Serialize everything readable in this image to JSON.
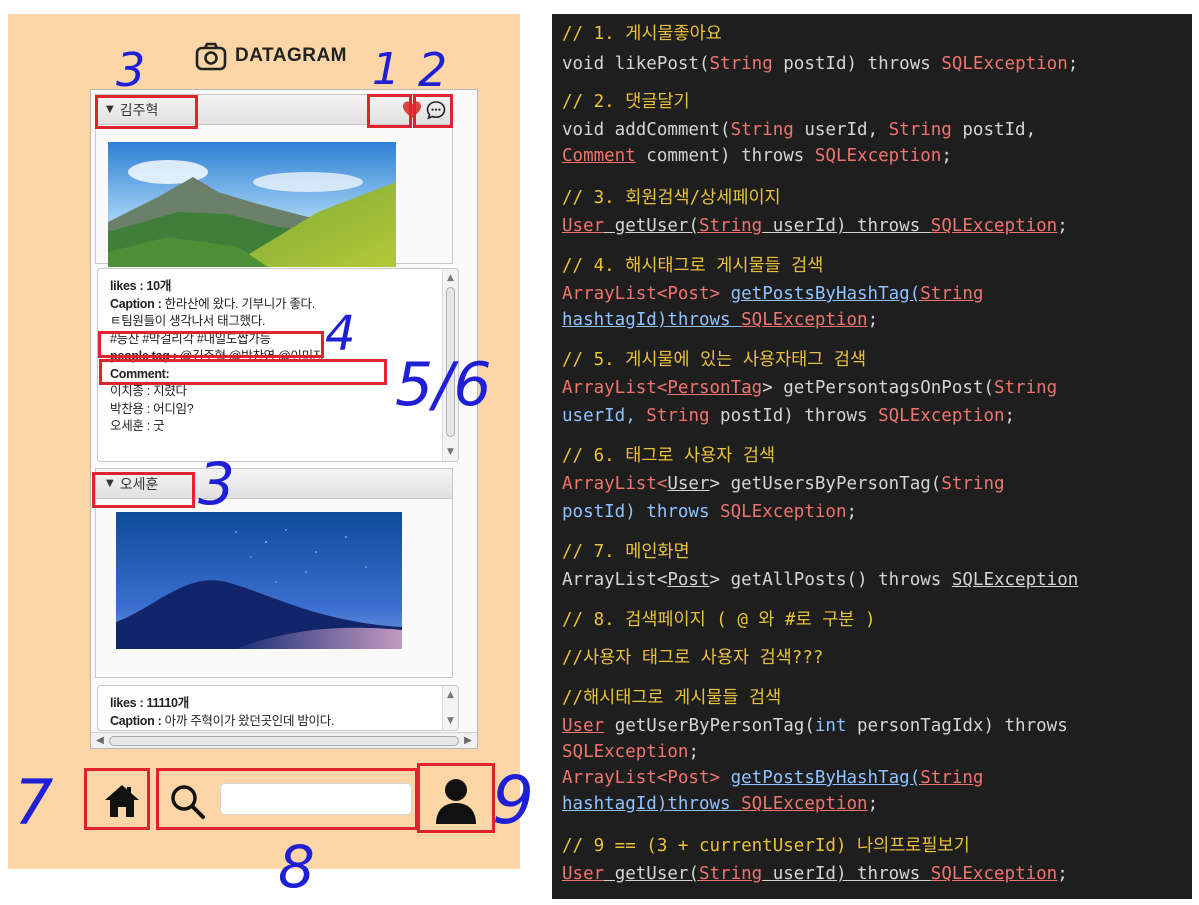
{
  "app": {
    "title": "DATAGRAM",
    "bg_color": "#fcd6a6",
    "icons": {
      "title": "camera-icon",
      "like": "heart-icon",
      "comment": "comment-icon",
      "home": "home-icon",
      "search": "search-icon",
      "profile": "user-icon"
    },
    "posts": [
      {
        "username": "김주혁",
        "likes_label": "likes : ",
        "likes_value": "10개",
        "caption_label": "Caption : ",
        "caption_text": "한라산에 왔다. 기부니가 좋다.",
        "caption_line2": "ㅌ팀원들이 생각나서 태그했다.",
        "hashtags": "#등산 #막걸리각 #내일도쌉가능",
        "people_tag_label": "people tag : ",
        "people_tags": "@김주혁 @박찬영 @이미자",
        "comment_label": "Comment:",
        "comments": [
          {
            "user": "이치종",
            "text": " : 지렸다"
          },
          {
            "user": "박찬용",
            "text": " : 어디임?"
          },
          {
            "user": "오세훈",
            "text": " : 굿"
          }
        ]
      },
      {
        "username": "오세훈",
        "likes_label": "likes : ",
        "likes_value": "11110개",
        "caption_label": "Caption : ",
        "caption_text": "아까 주혁이가 왔던곳인데 밤이다."
      }
    ],
    "search": {
      "value": "",
      "placeholder": ""
    }
  },
  "annotations": {
    "n1": "1",
    "n2": "2",
    "n3a": "3",
    "n3b": "3",
    "n4": "4",
    "n56": "5/6",
    "n7": "7",
    "n8": "8",
    "n9": "9"
  },
  "code": {
    "c1": "// 1. 게시물좋아요",
    "l1": {
      "a": "void likePost(",
      "b": "String",
      "c": " postId) throws ",
      "d": "SQLException",
      "e": ";"
    },
    "c2": "// 2. 댓글달기",
    "l2a": {
      "a": "void addComment(",
      "b": "String",
      "c": " userId, ",
      "d": "String",
      "e": " postId,"
    },
    "l2b": {
      "a": "Comment",
      "b": " comment) throws ",
      "c": "SQLException",
      "d": ";"
    },
    "c3": "// 3. 회원검색/상세페이지",
    "l3": {
      "a": "User",
      "b": " getUser(",
      "c": "String",
      "d": " userId) throws ",
      "e": "SQLException",
      "f": ";"
    },
    "c4": "// 4. 해시태그로 게시물들 검색",
    "l4a": {
      "a": "ArrayList<",
      "b": "Post",
      "c": "> ",
      "d": "getPostsByHashTag(",
      "e": "String"
    },
    "l4b": {
      "a": "hashtagId)throws ",
      "b": "SQLException",
      "c": ";"
    },
    "c5": "// 5. 게시물에 있는 사용자태그 검색",
    "l5a": {
      "a": "ArrayList<",
      "b": "PersonTag",
      "c": "> getPersontagsOnPost(",
      "d": "String"
    },
    "l5b": {
      "a": "userId, ",
      "b": "String",
      "c": " postId) throws ",
      "d": "SQLException",
      "e": ";"
    },
    "c6": "// 6. 태그로 사용자 검색",
    "l6a": {
      "a": "ArrayList<",
      "b": "User",
      "c": "> getUsersByPersonTag(",
      "d": "String"
    },
    "l6b": {
      "a": "postId) throws ",
      "b": "SQLException",
      "c": ";"
    },
    "c7": "// 7. 메인화면",
    "l7": {
      "a": "ArrayList<",
      "b": "Post",
      "c": "> getAllPosts() throws ",
      "d": "SQLException"
    },
    "c8": "// 8. 검색페이지 ( @ 와 #로 구분 )",
    "c8b": "//사용자 태그로 사용자 검색???",
    "c8c": "//해시태그로 게시물들 검색",
    "l8a": {
      "a": "User",
      "b": " getUserByPersonTag(",
      "c": "int",
      "d": " personTagIdx) throws"
    },
    "l8b": {
      "a": "SQLException",
      "b": ";"
    },
    "l8c": {
      "a": "ArrayList<",
      "b": "Post",
      "c": "> ",
      "d": "getPostsByHashTag(",
      "e": "String"
    },
    "l8d": {
      "a": "hashtagId)throws ",
      "b": "SQLException",
      "c": ";"
    },
    "c9": "// 9 == (3 + currentUserId) 나의프로필보기",
    "l9": {
      "a": "User",
      "b": " getUser(",
      "c": "String",
      "d": " userId) throws ",
      "e": "SQLException",
      "f": ";"
    }
  }
}
